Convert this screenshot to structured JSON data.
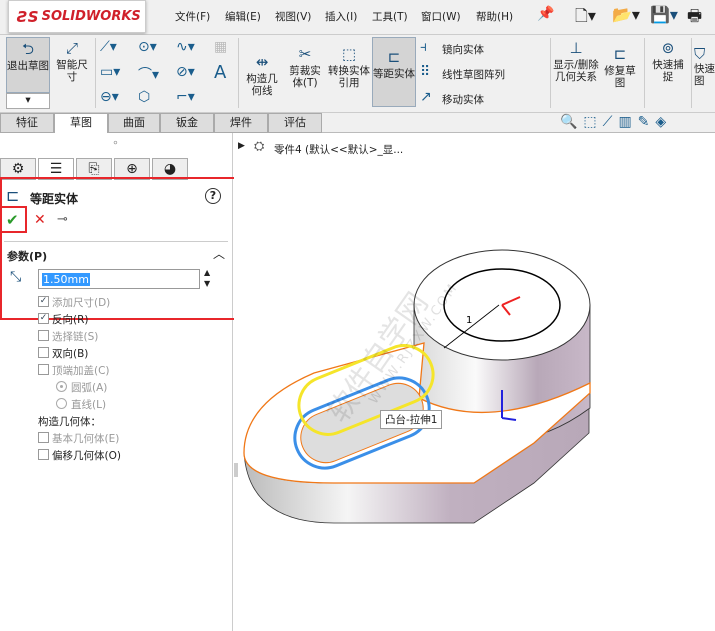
{
  "app": {
    "logo": "SOLIDWORKS"
  },
  "menu": [
    "文件(F)",
    "编辑(E)",
    "视图(V)",
    "插入(I)",
    "工具(T)",
    "窗口(W)",
    "帮助(H)"
  ],
  "toolbar": {
    "exit_sketch": "退出草图",
    "smart_dim": "智能尺寸",
    "construction": "构造几何线",
    "trim": "剪裁实体(T)",
    "convert": "转换实体引用",
    "offset": "等距实体",
    "mirror": "镜向实体",
    "linear_pattern": "线性草图阵列",
    "move": "移动实体",
    "relations": "显示/删除几何关系",
    "repair": "修复草图",
    "quick_snap": "快速捕捉",
    "quick_view": "快速草图"
  },
  "tabs": [
    "特征",
    "草图",
    "曲面",
    "钣金",
    "焊件",
    "评估"
  ],
  "active_tab": "草图",
  "breadcrumb": "零件4  (默认<<默认>_显...",
  "panel": {
    "title": "等距实体",
    "section": "参数(P)",
    "offset_value": "1.50mm",
    "options": [
      {
        "label": "添加尺寸(D)",
        "checked": true,
        "enabled": false
      },
      {
        "label": "反向(R)",
        "checked": true,
        "enabled": true
      },
      {
        "label": "选择链(S)",
        "checked": false,
        "enabled": false
      },
      {
        "label": "双向(B)",
        "checked": false,
        "enabled": true
      },
      {
        "label": "顶端加盖(C)",
        "checked": false,
        "enabled": false
      }
    ],
    "cap_options": [
      {
        "label": "圆弧(A)",
        "selected": true
      },
      {
        "label": "直线(L)",
        "selected": false
      }
    ],
    "construction_title": "构造几何体：",
    "construction_options": [
      {
        "label": "基本几何体(E)",
        "checked": false,
        "enabled": false
      },
      {
        "label": "偏移几何体(O)",
        "checked": false,
        "enabled": true
      }
    ]
  },
  "viewport": {
    "tooltip": "凸台-拉伸1",
    "watermark": "软件自学网",
    "watermark2": "WWW.RJZXW.COM",
    "dim_label": "1"
  },
  "colors": {
    "highlight": "#e8262b",
    "accent": "#1a5d8c",
    "selection_blue": "#3b8fe8",
    "selection_yellow": "#f5e52a",
    "edge_orange": "#f07818"
  }
}
